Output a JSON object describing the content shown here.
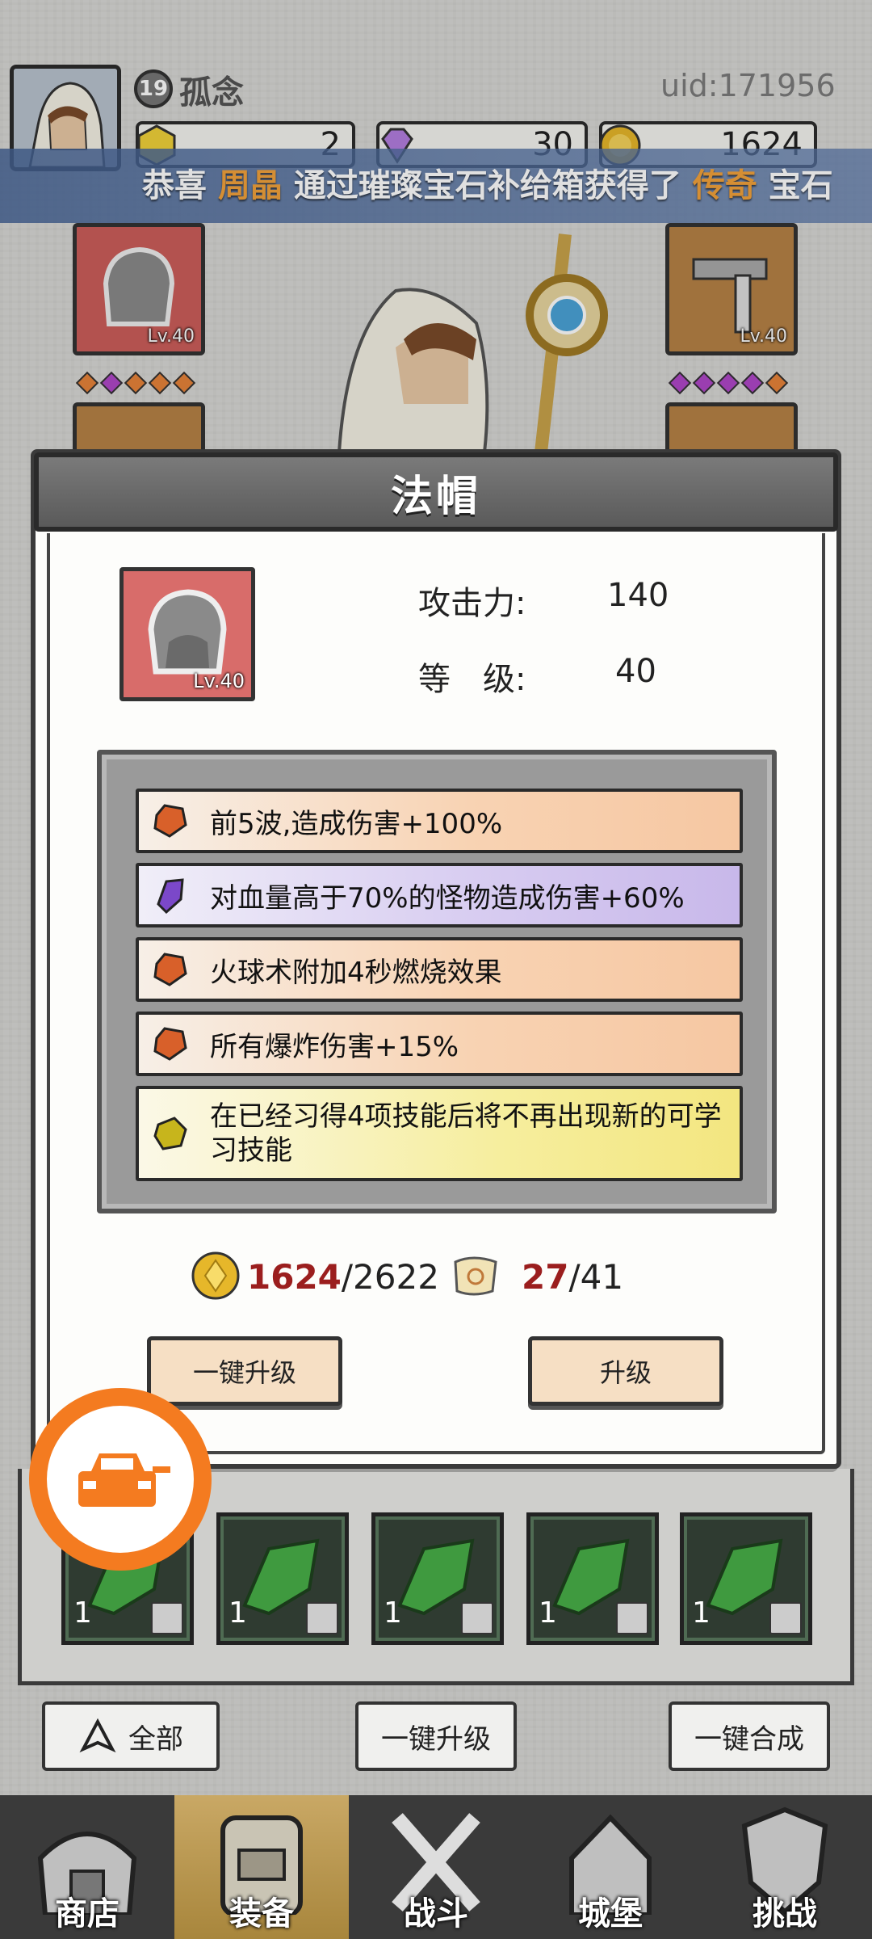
{
  "player": {
    "level": "19",
    "name": "孤念",
    "uid": "uid:171956"
  },
  "currencies": [
    {
      "name": "energy",
      "icon": "yellow-crystal-icon",
      "value": "2"
    },
    {
      "name": "gems",
      "icon": "purple-gem-icon",
      "value": "30"
    },
    {
      "name": "gold",
      "icon": "gold-coin-icon",
      "value": "1624"
    }
  ],
  "broadcast": {
    "part1": "恭喜",
    "player": "周晶",
    "part2": "通过璀璨宝石补给箱获得了",
    "rarity": "传奇",
    "part3": "宝石"
  },
  "equipment_slots": {
    "head_level": "Lv.40",
    "weapon_level": "Lv.40"
  },
  "modal": {
    "title": "法帽",
    "item_level": "Lv.40",
    "attack_label": "攻击力:",
    "attack_value": "140",
    "level_label": "等　级:",
    "level_value": "40",
    "skills": [
      {
        "text": "前5波,造成伤害+100%",
        "rarity": "orange",
        "icon": "orange-gem-icon"
      },
      {
        "text": "对血量高于70%的怪物造成伤害+60%",
        "rarity": "purple",
        "icon": "purple-gem-icon"
      },
      {
        "text": "火球术附加4秒燃烧效果",
        "rarity": "orange",
        "icon": "orange-gem-icon"
      },
      {
        "text": "所有爆炸伤害+15%",
        "rarity": "orange",
        "icon": "orange-gem-icon"
      },
      {
        "text": "在已经习得4项技能后将不再出现新的可学习技能",
        "rarity": "yellow",
        "icon": "yellow-gem-icon"
      }
    ],
    "gold_cost_current": "1624",
    "gold_cost_required": "/2622",
    "scroll_cost_current": "27",
    "scroll_cost_required": "/41",
    "one_click_upgrade": "一键升级",
    "upgrade": "升级"
  },
  "inventory": {
    "counts": [
      "1",
      "1",
      "1",
      "1",
      "1"
    ]
  },
  "actions": {
    "filter_all": "全部",
    "one_click_upgrade": "一键升级",
    "one_click_merge": "一键合成"
  },
  "tabs": [
    {
      "label": "商店",
      "icon": "shop-icon"
    },
    {
      "label": "装备",
      "icon": "bag-icon"
    },
    {
      "label": "战斗",
      "icon": "crossed-swords-icon"
    },
    {
      "label": "城堡",
      "icon": "castle-icon"
    },
    {
      "label": "挑战",
      "icon": "shield-icon"
    }
  ],
  "colors": {
    "accent_orange": "#f47b20",
    "highlight_text": "#f2a23c",
    "cost_red": "#9b1e1e"
  }
}
